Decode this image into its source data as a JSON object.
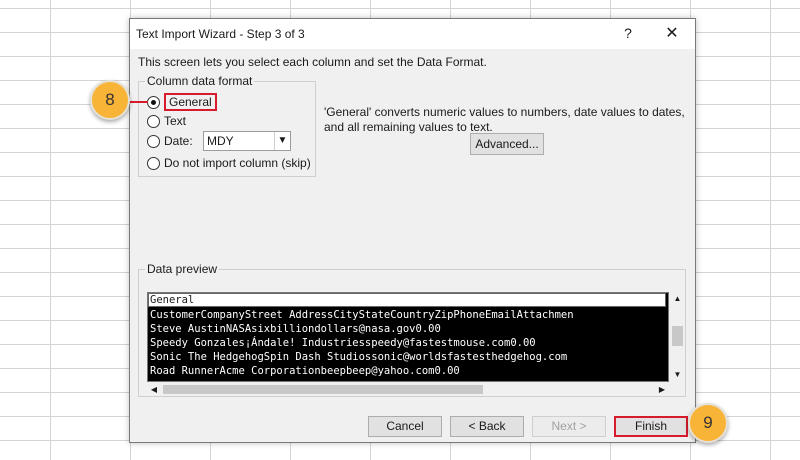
{
  "dialog": {
    "title": "Text Import Wizard - Step 3 of 3",
    "help": "?",
    "close": "✕",
    "intro": "This screen lets you select each column and set the Data Format."
  },
  "column_format": {
    "legend": "Column data format",
    "options": [
      {
        "label": "General",
        "selected": true
      },
      {
        "label": "Text",
        "selected": false
      },
      {
        "label": "Date:",
        "selected": false
      },
      {
        "label": "Do not import column (skip)",
        "selected": false
      }
    ],
    "date_value": "MDY"
  },
  "description": "'General' converts numeric values to numbers, date values to dates, and all remaining values to text.",
  "advanced_label": "Advanced...",
  "preview": {
    "legend": "Data preview",
    "header": "General",
    "lines": [
      "CustomerCompanyStreet AddressCityStateCountryZipPhoneEmailAttachmen",
      "Steve AustinNASAsixbilliondollars@nasa.gov0.00",
      "Speedy Gonzales¡Ándale! Industriesspeedy@fastestmouse.com0.00",
      "Sonic The HedgehogSpin Dash Studiossonic@worldsfastesthedgehog.com",
      "Road RunnerAcme Corporationbeepbeep@yahoo.com0.00"
    ]
  },
  "buttons": {
    "cancel": "Cancel",
    "back": "< Back",
    "next": "Next >",
    "finish": "Finish"
  },
  "callouts": {
    "step_8": "8",
    "step_9": "9"
  },
  "colors": {
    "highlight": "#d81b2c",
    "callout": "#f8b437"
  }
}
